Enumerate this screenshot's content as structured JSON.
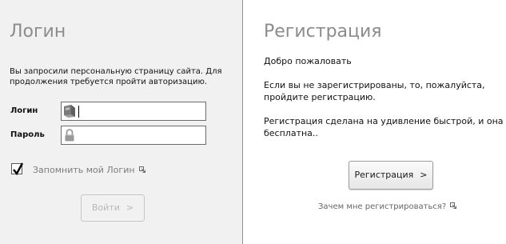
{
  "login": {
    "title": "Логин",
    "intro": "Вы запросили персональную страницу сайта. Для продолжения требуется пройти авторизацию.",
    "login_label": "Логин",
    "login_value": "",
    "password_label": "Пароль",
    "password_value": "",
    "remember_label": "Запомнить мой Логин",
    "remember_checked": true,
    "submit_label": "Войти",
    "submit_arrow": ">",
    "submit_enabled": false
  },
  "register": {
    "title": "Регистрация",
    "welcome": "Добро пожаловать",
    "line1": "Если вы не зарегистрированы, то, пожалуйста,",
    "line2": "пройдите регистрацию.",
    "line3": "Регистрация сделана на удивление быстрой, и она",
    "line4": "бесплатна..",
    "button_label": "Регистрация",
    "button_arrow": ">",
    "why_link": "Зачем мне регистрироваться?"
  },
  "icons": {
    "login_field": "user-card-icon",
    "password_field": "padlock-icon",
    "external_link": "external-link-icon",
    "checkbox": "checkmark-icon"
  },
  "colors": {
    "login_pane_bg": "#f1f1f1",
    "heading": "#8c8c8c",
    "disabled_text": "#b9b9b9",
    "muted_text": "#7d7d7d"
  }
}
